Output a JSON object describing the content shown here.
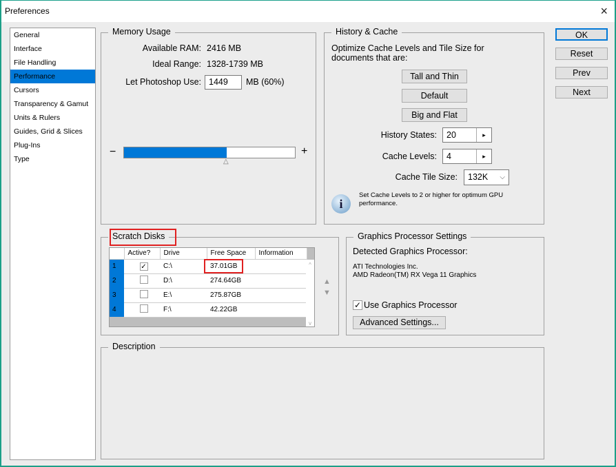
{
  "window": {
    "title": "Preferences",
    "close_icon": "×"
  },
  "sidebar": {
    "items": [
      {
        "label": "General",
        "selected": false
      },
      {
        "label": "Interface",
        "selected": false
      },
      {
        "label": "File Handling",
        "selected": false
      },
      {
        "label": "Performance",
        "selected": true
      },
      {
        "label": "Cursors",
        "selected": false
      },
      {
        "label": "Transparency & Gamut",
        "selected": false
      },
      {
        "label": "Units & Rulers",
        "selected": false
      },
      {
        "label": "Guides, Grid & Slices",
        "selected": false
      },
      {
        "label": "Plug-Ins",
        "selected": false
      },
      {
        "label": "Type",
        "selected": false
      }
    ]
  },
  "memory": {
    "title": "Memory Usage",
    "available_label": "Available RAM:",
    "available_value": "2416 MB",
    "ideal_label": "Ideal Range:",
    "ideal_value": "1328-1739 MB",
    "use_label": "Let Photoshop Use:",
    "use_value": "1449",
    "use_unit": "MB (60%)",
    "slider_fraction": 0.6,
    "minus": "−",
    "plus": "+"
  },
  "history": {
    "title": "History & Cache",
    "optimize_text": "Optimize Cache Levels and Tile Size for documents that are:",
    "buttons": [
      "Tall and Thin",
      "Default",
      "Big and Flat"
    ],
    "history_states_label": "History States:",
    "history_states_value": "20",
    "cache_levels_label": "Cache Levels:",
    "cache_levels_value": "4",
    "tile_size_label": "Cache Tile Size:",
    "tile_size_value": "132K",
    "info_text": "Set Cache Levels to 2 or higher for optimum GPU performance.",
    "arrow": "▸",
    "dropdown": "⌵"
  },
  "actions": {
    "ok": "OK",
    "reset": "Reset",
    "prev": "Prev",
    "next": "Next"
  },
  "scratch": {
    "title": "Scratch Disks",
    "columns": [
      "Active?",
      "Drive",
      "Free Space",
      "Information"
    ],
    "rows": [
      {
        "num": "1",
        "active": true,
        "drive": "C:\\",
        "free": "37.01GB",
        "info": ""
      },
      {
        "num": "2",
        "active": false,
        "drive": "D:\\",
        "free": "274.64GB",
        "info": ""
      },
      {
        "num": "3",
        "active": false,
        "drive": "E:\\",
        "free": "275.87GB",
        "info": ""
      },
      {
        "num": "4",
        "active": false,
        "drive": "F:\\",
        "free": "42.22GB",
        "info": ""
      }
    ],
    "move_up": "▲",
    "move_down": "▼"
  },
  "gpu": {
    "title": "Graphics Processor Settings",
    "detected_label": "Detected Graphics Processor:",
    "vendor": "ATI Technologies Inc.",
    "model": "AMD Radeon(TM) RX Vega 11 Graphics",
    "use_gpu_label": "Use Graphics Processor",
    "use_gpu_checked": true,
    "advanced_button": "Advanced Settings..."
  },
  "description": {
    "title": "Description",
    "text": ""
  }
}
